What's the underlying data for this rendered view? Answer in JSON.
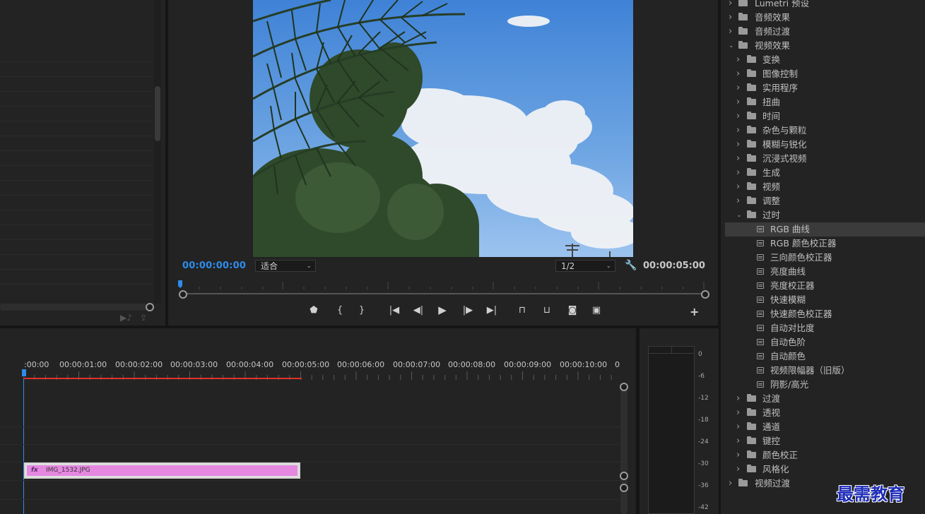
{
  "program": {
    "timecode_in": "00:00:00:00",
    "fit_select": "适合",
    "resolution_select": "1/2",
    "timecode_duration": "00:00:05:00"
  },
  "timeline": {
    "ticks": [
      ":00:00",
      "00:00:01:00",
      "00:00:02:00",
      "00:00:03:00",
      "00:00:04:00",
      "00:00:05:00",
      "00:00:06:00",
      "00:00:07:00",
      "00:00:08:00",
      "00:00:09:00",
      "00:00:10:00",
      "0"
    ],
    "clip": {
      "fx": "fx",
      "name": "IMG_1532.JPG"
    }
  },
  "meters": {
    "db_labels": [
      "0",
      "-6",
      "-12",
      "-18",
      "-24",
      "-30",
      "-36",
      "-42"
    ]
  },
  "effects": {
    "rows": [
      {
        "label": "Lumetri 预设",
        "type": "folder",
        "level": 0,
        "expanded": false
      },
      {
        "label": "音频效果",
        "type": "folder",
        "level": 0,
        "expanded": false
      },
      {
        "label": "音频过渡",
        "type": "folder",
        "level": 0,
        "expanded": false
      },
      {
        "label": "视频效果",
        "type": "folder",
        "level": 0,
        "expanded": true
      },
      {
        "label": "变换",
        "type": "folder",
        "level": 1,
        "expanded": false
      },
      {
        "label": "图像控制",
        "type": "folder",
        "level": 1,
        "expanded": false
      },
      {
        "label": "实用程序",
        "type": "folder",
        "level": 1,
        "expanded": false
      },
      {
        "label": "扭曲",
        "type": "folder",
        "level": 1,
        "expanded": false
      },
      {
        "label": "时间",
        "type": "folder",
        "level": 1,
        "expanded": false
      },
      {
        "label": "杂色与颗粒",
        "type": "folder",
        "level": 1,
        "expanded": false
      },
      {
        "label": "模糊与锐化",
        "type": "folder",
        "level": 1,
        "expanded": false
      },
      {
        "label": "沉浸式视频",
        "type": "folder",
        "level": 1,
        "expanded": false
      },
      {
        "label": "生成",
        "type": "folder",
        "level": 1,
        "expanded": false
      },
      {
        "label": "视频",
        "type": "folder",
        "level": 1,
        "expanded": false
      },
      {
        "label": "调整",
        "type": "folder",
        "level": 1,
        "expanded": false
      },
      {
        "label": "过时",
        "type": "folder",
        "level": 1,
        "expanded": true
      },
      {
        "label": "RGB 曲线",
        "type": "effect",
        "level": 2,
        "selected": true
      },
      {
        "label": "RGB 颜色校正器",
        "type": "effect",
        "level": 2
      },
      {
        "label": "三向颜色校正器",
        "type": "effect",
        "level": 2
      },
      {
        "label": "亮度曲线",
        "type": "effect",
        "level": 2
      },
      {
        "label": "亮度校正器",
        "type": "effect",
        "level": 2
      },
      {
        "label": "快速模糊",
        "type": "effect",
        "level": 2
      },
      {
        "label": "快速颜色校正器",
        "type": "effect",
        "level": 2
      },
      {
        "label": "自动对比度",
        "type": "effect",
        "level": 2
      },
      {
        "label": "自动色阶",
        "type": "effect",
        "level": 2
      },
      {
        "label": "自动颜色",
        "type": "effect",
        "level": 2
      },
      {
        "label": "视频限幅器（旧版）",
        "type": "effect",
        "level": 2
      },
      {
        "label": "阴影/高光",
        "type": "effect",
        "level": 2
      },
      {
        "label": "过渡",
        "type": "folder",
        "level": 1,
        "expanded": false
      },
      {
        "label": "透视",
        "type": "folder",
        "level": 1,
        "expanded": false
      },
      {
        "label": "通道",
        "type": "folder",
        "level": 1,
        "expanded": false
      },
      {
        "label": "键控",
        "type": "folder",
        "level": 1,
        "expanded": false
      },
      {
        "label": "颜色校正",
        "type": "folder",
        "level": 1,
        "expanded": false
      },
      {
        "label": "风格化",
        "type": "folder",
        "level": 1,
        "expanded": false
      },
      {
        "label": "视频过渡",
        "type": "folder",
        "level": 0,
        "expanded": false
      }
    ]
  },
  "watermark": "最需教育"
}
